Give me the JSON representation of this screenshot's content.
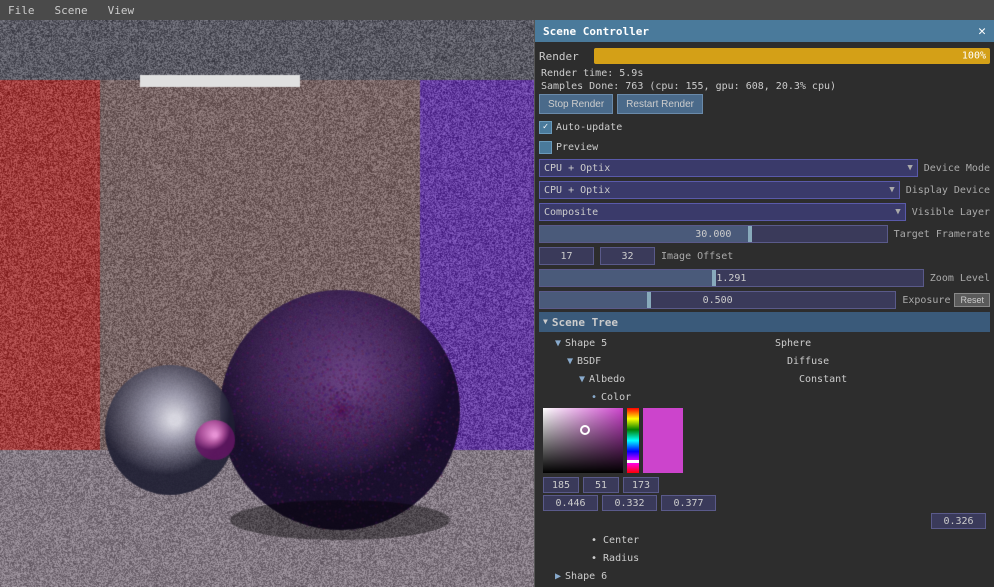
{
  "menu": {
    "items": [
      "File",
      "Scene",
      "View"
    ]
  },
  "panel": {
    "title": "Scene Controller",
    "close_label": "✕"
  },
  "render": {
    "label": "Render",
    "progress": 100,
    "progress_text": "100%",
    "time_label": "Render time: 5.9s",
    "samples_label": "Samples Done: 763 (cpu: 155, gpu: 608, 20.3% cpu)",
    "stop_button": "Stop Render",
    "restart_button": "Restart Render"
  },
  "checkboxes": {
    "auto_update": "Auto-update",
    "preview": "Preview"
  },
  "device_mode": {
    "value": "CPU + Optix",
    "label": "Device Mode"
  },
  "display_device": {
    "value": "CPU + Optix",
    "label": "Display Device"
  },
  "visible_layer": {
    "value": "Composite",
    "label": "Visible Layer"
  },
  "target_framerate": {
    "value": "30.000",
    "slider_pos": 0.6,
    "label": "Target Framerate"
  },
  "image_offset": {
    "val1": "17",
    "val2": "32",
    "label": "Image Offset"
  },
  "zoom_level": {
    "value": "1.291",
    "label": "Zoom Level"
  },
  "exposure": {
    "value": "0.500",
    "label": "Exposure",
    "reset": "Reset"
  },
  "scene_tree": {
    "title": "Scene Tree",
    "items": [
      {
        "indent": 1,
        "arrow": "▼",
        "text": "Shape 5",
        "right": "Sphere"
      },
      {
        "indent": 2,
        "arrow": "▼",
        "text": "BSDF",
        "right": "Diffuse"
      },
      {
        "indent": 3,
        "arrow": "▼",
        "text": "Albedo",
        "right": "Constant"
      },
      {
        "indent": 4,
        "dot": "•",
        "text": "Color",
        "right": ""
      }
    ]
  },
  "color_picker": {
    "rgb": [
      185,
      51,
      173
    ],
    "rgb_labels": [
      "185",
      "51",
      "173"
    ],
    "float_values": [
      "0.446",
      "0.332",
      "0.377"
    ],
    "float_val4": "0.326"
  },
  "center": {
    "label": "• Center"
  },
  "radius": {
    "label": "• Radius"
  },
  "shape6": {
    "label": "Shape 6"
  }
}
